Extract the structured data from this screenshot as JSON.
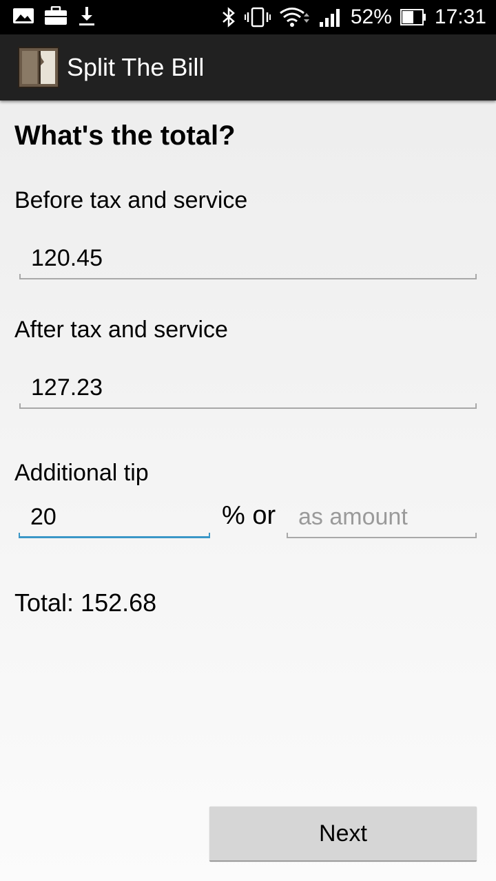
{
  "status_bar": {
    "left_icons": [
      "image-icon",
      "briefcase-icon",
      "download-icon"
    ],
    "right_icons": [
      "bluetooth-icon",
      "vibrate-icon",
      "wifi-icon",
      "signal-icon",
      "battery-icon"
    ],
    "battery": "52%",
    "time": "17:31"
  },
  "action_bar": {
    "title": "Split The Bill",
    "logo_icon": "app-logo-icon",
    "background": "#212121"
  },
  "form": {
    "heading": "What's the total?",
    "before_label": "Before tax and service",
    "before_value": "120.45",
    "after_label": "After tax and service",
    "after_value": "127.23",
    "tip_label": "Additional tip",
    "tip_percent_value": "20",
    "percent_or": "% or",
    "tip_amount_placeholder": "as amount",
    "total_text": "Total: 152.68",
    "focus_color": "#3a97c7"
  },
  "buttons": {
    "next": "Next"
  }
}
